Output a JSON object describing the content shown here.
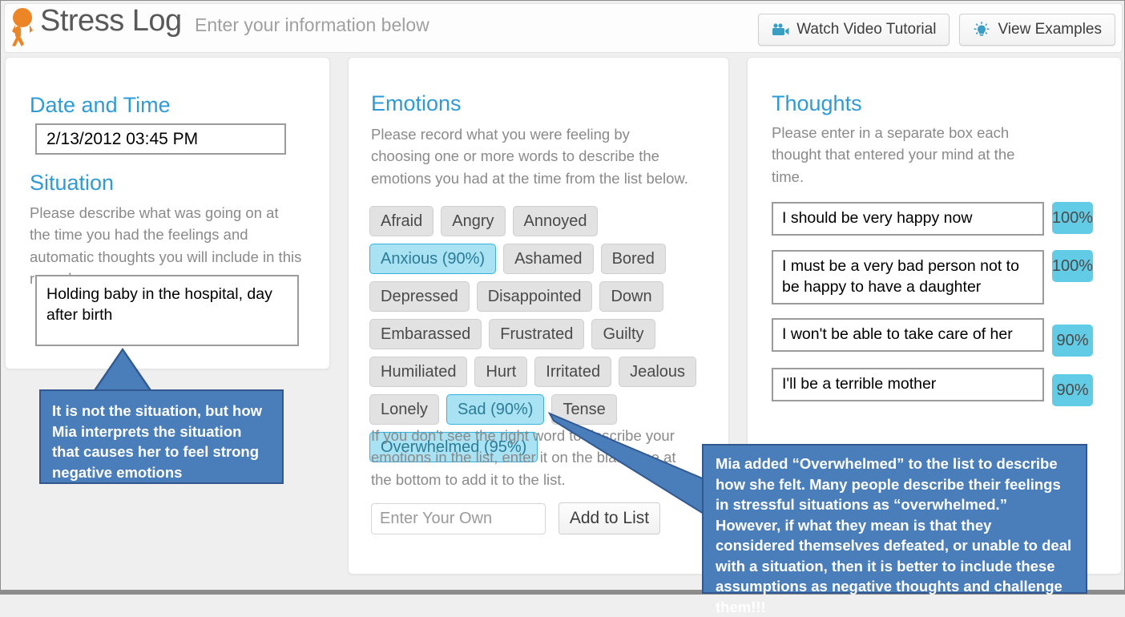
{
  "header": {
    "brand_title": "Stress Log",
    "brand_subtitle": "Enter your information below",
    "logo_icon": "stress-figure-icon",
    "buttons": [
      {
        "label": "Watch Video Tutorial",
        "icon": "video-camera-icon"
      },
      {
        "label": "View Examples",
        "icon": "lightbulb-icon"
      }
    ]
  },
  "left_panel": {
    "datetime_title": "Date and Time",
    "datetime_value": "2/13/2012  03:45 PM",
    "situation_title": "Situation",
    "situation_help": "Please describe what was going on at the time you had the feelings and automatic thoughts you will include in this record.",
    "situation_value": "Holding baby in the hospital, day after birth"
  },
  "emotions_panel": {
    "title": "Emotions",
    "help": "Please record what you were feeling by choosing one or more words to describe the emotions you had at the time from the list below.",
    "help2": "If you don't see the right word to describe your emotions in the list, enter it on the blank line at the bottom to add it to the list.",
    "tags": [
      {
        "label": "Afraid",
        "selected": false
      },
      {
        "label": "Angry",
        "selected": false
      },
      {
        "label": "Annoyed",
        "selected": false
      },
      {
        "label": "Anxious (90%)",
        "selected": true
      },
      {
        "label": "Ashamed",
        "selected": false
      },
      {
        "label": "Bored",
        "selected": false
      },
      {
        "label": "Depressed",
        "selected": false
      },
      {
        "label": "Disappointed",
        "selected": false
      },
      {
        "label": "Down",
        "selected": false
      },
      {
        "label": "Embarassed",
        "selected": false
      },
      {
        "label": "Frustrated",
        "selected": false
      },
      {
        "label": "Guilty",
        "selected": false
      },
      {
        "label": "Humiliated",
        "selected": false
      },
      {
        "label": "Hurt",
        "selected": false
      },
      {
        "label": "Irritated",
        "selected": false
      },
      {
        "label": "Jealous",
        "selected": false
      },
      {
        "label": "Lonely",
        "selected": false
      },
      {
        "label": "Sad (90%)",
        "selected": true
      },
      {
        "label": "Tense",
        "selected": false
      },
      {
        "label": "Overwhelmed (95%)",
        "selected": true
      }
    ],
    "own_placeholder": "Enter Your Own",
    "own_value": "",
    "add_button": "Add to List"
  },
  "thoughts_panel": {
    "title": "Thoughts",
    "help": "Please enter in a separate box each thought that entered your mind at the time.",
    "thoughts": [
      {
        "text": "I should be very happy now",
        "percent": "100%"
      },
      {
        "text": "I must be a very bad person not  to be happy to have a daughter",
        "percent": "100%"
      },
      {
        "text": "I won't be able to take care of her",
        "percent": "90%"
      },
      {
        "text": "I'll be a terrible mother",
        "percent": "90%"
      }
    ]
  },
  "annotations": {
    "left_callout": "It is not the situation, but how Mia interprets the situation that causes her to feel strong negative emotions",
    "right_callout": "Mia added “Overwhelmed” to the list to describe how she felt. Many people describe their feelings in stressful situations as “overwhelmed.” However, if what they mean is that they considered themselves defeated, or unable to deal with a situation, then it is better to include these assumptions as negative thoughts and challenge them!!!"
  },
  "colors": {
    "accent_blue": "#2e9bd6",
    "selected_tag_bg": "#a9e2f3",
    "percent_badge_bg": "#62cbe6",
    "callout_bg": "#4a7ebb",
    "logo_orange": "#ec8526"
  }
}
